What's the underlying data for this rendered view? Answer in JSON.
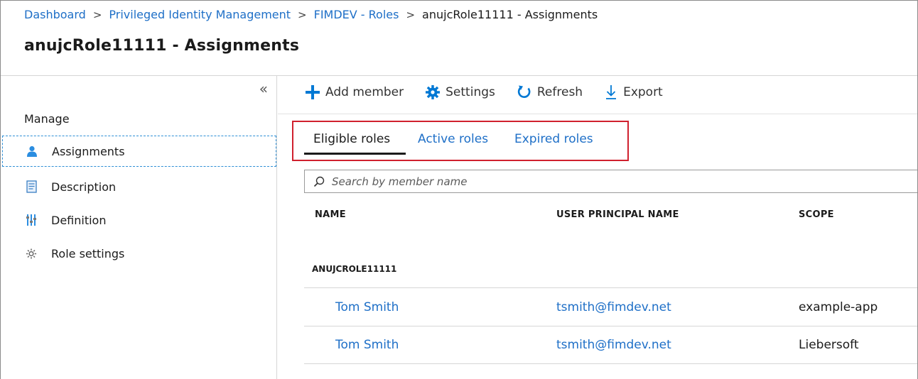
{
  "breadcrumb": {
    "items": [
      "Dashboard",
      "Privileged Identity Management",
      "FIMDEV - Roles"
    ],
    "current": "anujcRole11111 - Assignments",
    "separator": ">"
  },
  "page": {
    "title": "anujcRole11111 - Assignments"
  },
  "sidebar": {
    "collapse_glyph": "«",
    "section_label": "Manage",
    "items": [
      {
        "label": "Assignments",
        "icon": "user-icon",
        "active": true
      },
      {
        "label": "Description",
        "icon": "document-icon",
        "active": false
      },
      {
        "label": "Definition",
        "icon": "sliders-icon",
        "active": false
      },
      {
        "label": "Role settings",
        "icon": "gear-icon",
        "active": false
      }
    ]
  },
  "toolbar": {
    "add_member": "Add member",
    "settings": "Settings",
    "refresh": "Refresh",
    "export": "Export"
  },
  "tabs": {
    "eligible": "Eligible roles",
    "active": "Active roles",
    "expired": "Expired roles"
  },
  "search": {
    "placeholder": "Search by member name"
  },
  "table": {
    "columns": [
      "NAME",
      "USER PRINCIPAL NAME",
      "SCOPE"
    ],
    "group": "ANUJCROLE11111",
    "rows": [
      {
        "name": "Tom Smith",
        "upn": "tsmith@fimdev.net",
        "scope": "example-app"
      },
      {
        "name": "Tom Smith",
        "upn": "tsmith@fimdev.net",
        "scope": "Liebersoft"
      }
    ]
  },
  "colors": {
    "link": "#1e6fc7",
    "accent_blue": "#0078d4",
    "highlight_red": "#d0202e",
    "active_outline": "#2e8fd6"
  }
}
